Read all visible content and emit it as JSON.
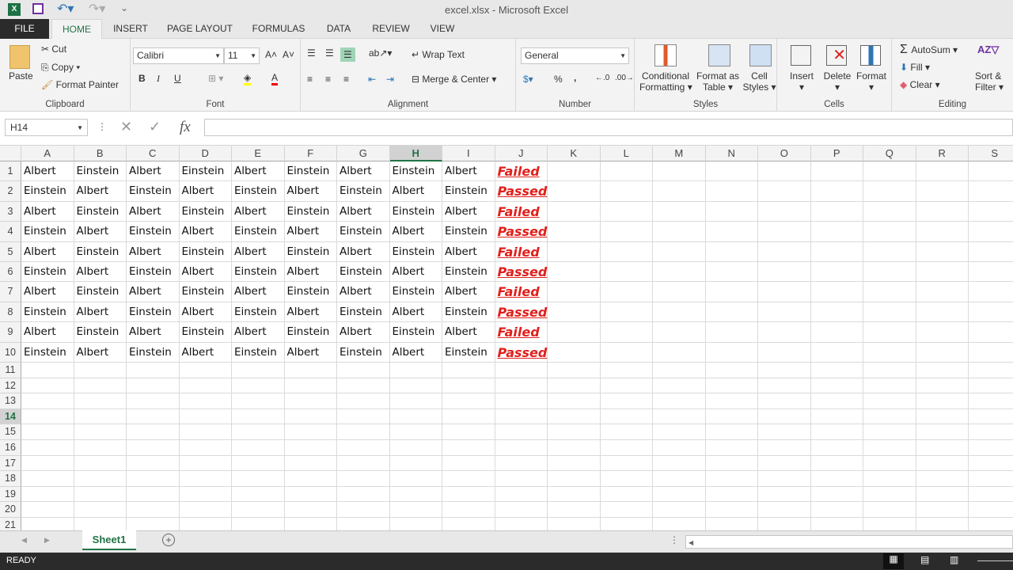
{
  "window": {
    "title": "excel.xlsx - Microsoft Excel"
  },
  "tabs": [
    "FILE",
    "HOME",
    "INSERT",
    "PAGE LAYOUT",
    "FORMULAS",
    "DATA",
    "REVIEW",
    "VIEW"
  ],
  "ribbon": {
    "clipboard": {
      "label": "Clipboard",
      "paste": "Paste",
      "cut": "Cut",
      "copy": "Copy",
      "format_painter": "Format Painter"
    },
    "font": {
      "label": "Font",
      "font_name": "Calibri",
      "font_size": "11",
      "bold": "B",
      "italic": "I",
      "underline": "U"
    },
    "alignment": {
      "label": "Alignment",
      "wrap_text": "Wrap Text",
      "merge_center": "Merge & Center"
    },
    "number": {
      "label": "Number",
      "format": "General",
      "percent": "%",
      "comma": ","
    },
    "styles": {
      "label": "Styles",
      "conditional_1": "Conditional",
      "conditional_2": "Formatting",
      "format_table_1": "Format as",
      "format_table_2": "Table",
      "cell_styles_1": "Cell",
      "cell_styles_2": "Styles"
    },
    "cells": {
      "label": "Cells",
      "insert": "Insert",
      "delete": "Delete",
      "format": "Format"
    },
    "editing": {
      "label": "Editing",
      "autosum": "AutoSum",
      "fill": "Fill",
      "clear": "Clear",
      "sort_1": "Sort &",
      "sort_2": "Filter"
    }
  },
  "formula_bar": {
    "name_box": "H14",
    "fx": "fx",
    "value": ""
  },
  "grid": {
    "columns": [
      "A",
      "B",
      "C",
      "D",
      "E",
      "F",
      "G",
      "H",
      "I",
      "J",
      "K",
      "L",
      "M",
      "N",
      "O",
      "P",
      "Q",
      "R",
      "S"
    ],
    "selected_column": "H",
    "selected_row": 14,
    "row_count": 21,
    "rows": [
      [
        "Albert",
        "Einstein",
        "Albert",
        "Einstein",
        "Albert",
        "Einstein",
        "Albert",
        "Einstein",
        "Albert",
        "Failed"
      ],
      [
        "Einstein",
        "Albert",
        "Einstein",
        "Albert",
        "Einstein",
        "Albert",
        "Einstein",
        "Albert",
        "Einstein",
        "Passed"
      ],
      [
        "Albert",
        "Einstein",
        "Albert",
        "Einstein",
        "Albert",
        "Einstein",
        "Albert",
        "Einstein",
        "Albert",
        "Failed"
      ],
      [
        "Einstein",
        "Albert",
        "Einstein",
        "Albert",
        "Einstein",
        "Albert",
        "Einstein",
        "Albert",
        "Einstein",
        "Passed"
      ],
      [
        "Albert",
        "Einstein",
        "Albert",
        "Einstein",
        "Albert",
        "Einstein",
        "Albert",
        "Einstein",
        "Albert",
        "Failed"
      ],
      [
        "Einstein",
        "Albert",
        "Einstein",
        "Albert",
        "Einstein",
        "Albert",
        "Einstein",
        "Albert",
        "Einstein",
        "Passed"
      ],
      [
        "Albert",
        "Einstein",
        "Albert",
        "Einstein",
        "Albert",
        "Einstein",
        "Albert",
        "Einstein",
        "Albert",
        "Failed"
      ],
      [
        "Einstein",
        "Albert",
        "Einstein",
        "Albert",
        "Einstein",
        "Albert",
        "Einstein",
        "Albert",
        "Einstein",
        "Passed"
      ],
      [
        "Albert",
        "Einstein",
        "Albert",
        "Einstein",
        "Albert",
        "Einstein",
        "Albert",
        "Einstein",
        "Albert",
        "Failed"
      ],
      [
        "Einstein",
        "Albert",
        "Einstein",
        "Albert",
        "Einstein",
        "Albert",
        "Einstein",
        "Albert",
        "Einstein",
        "Passed"
      ]
    ]
  },
  "sheets": {
    "active": "Sheet1"
  },
  "status": {
    "text": "READY"
  },
  "colors": {
    "accent": "#217346",
    "status_text": "#e0201c"
  }
}
